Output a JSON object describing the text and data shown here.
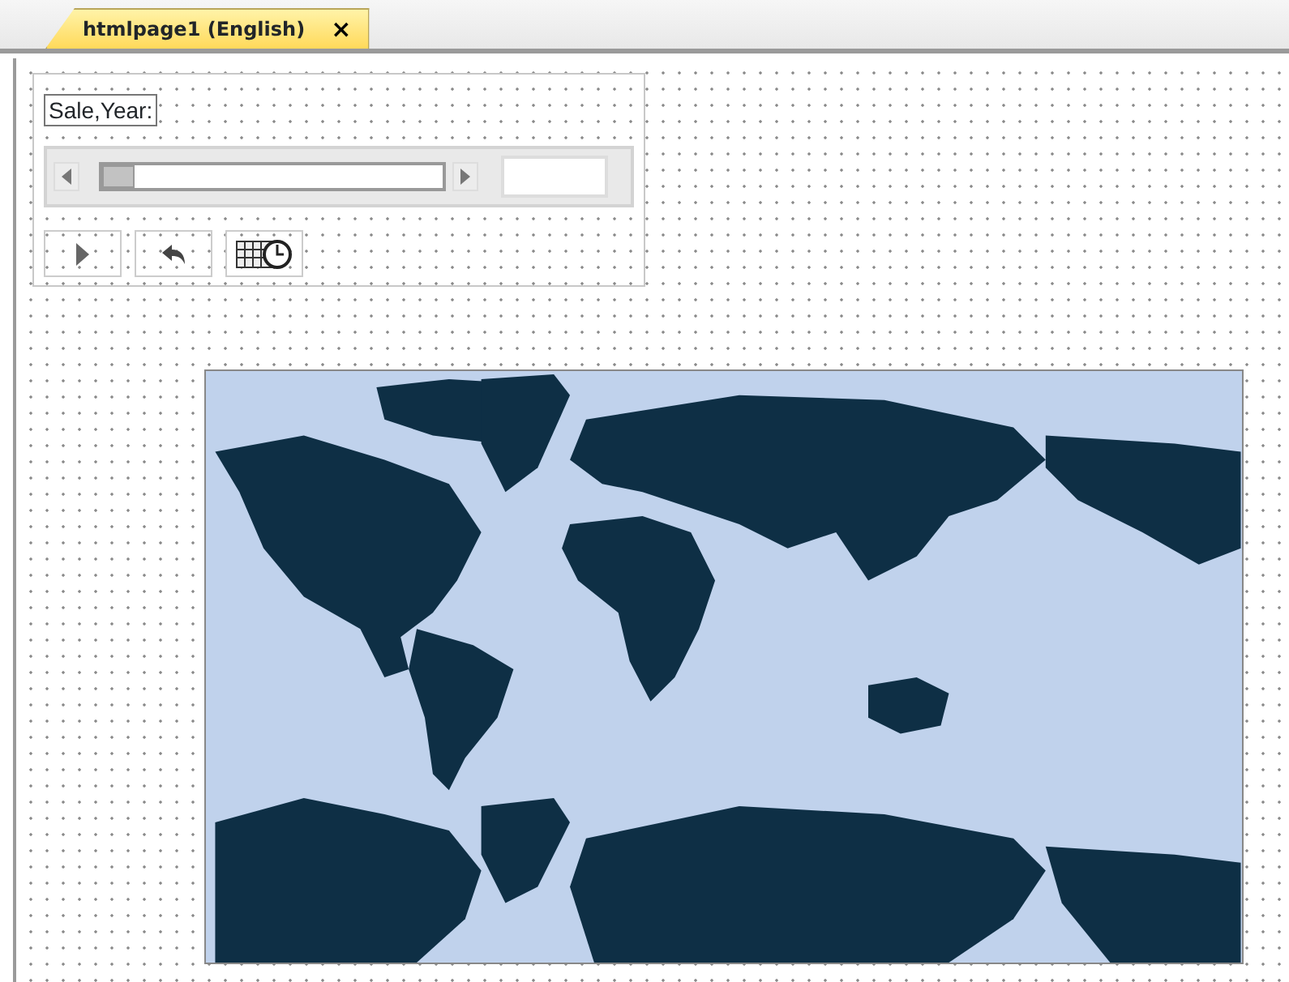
{
  "tabs": [
    {
      "label": "htmlpage1 (English)",
      "selected": true,
      "close": "×"
    }
  ],
  "panel": {
    "label": "Sale,Year:",
    "slider": {
      "level": 0.0
    }
  },
  "map": {
    "kind": "world"
  }
}
